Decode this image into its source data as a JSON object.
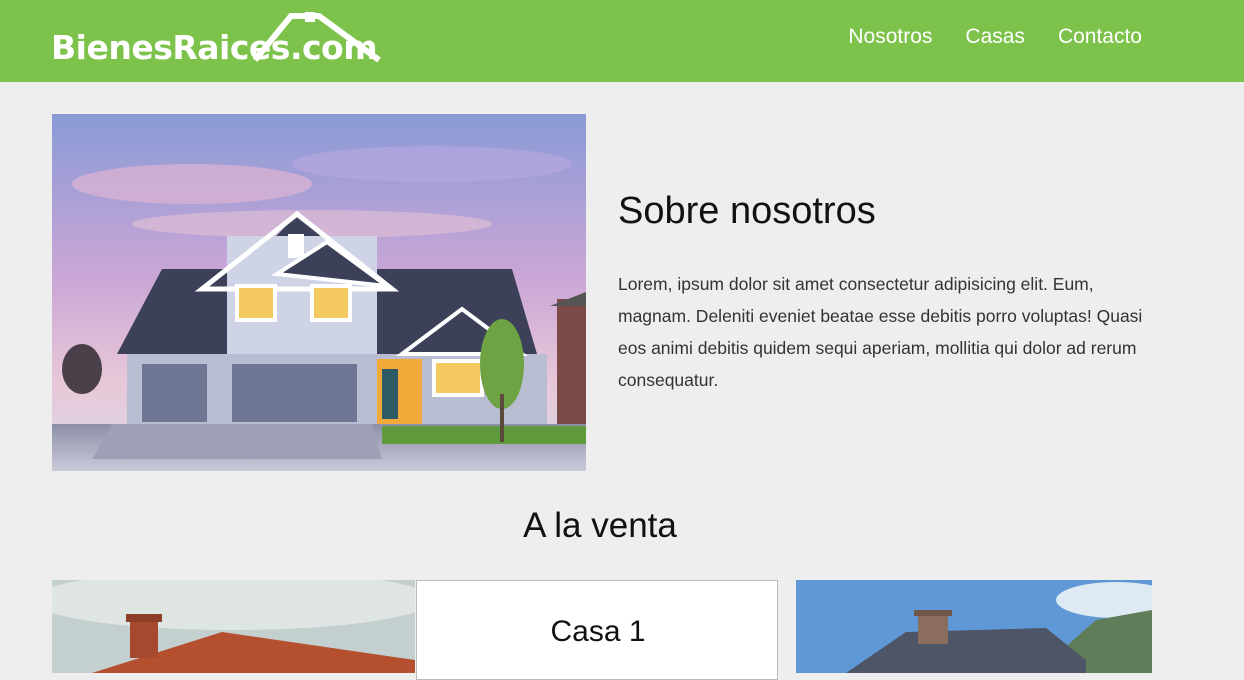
{
  "header": {
    "logo_text": "BienesRaices.com",
    "background_color": "#7dc24b",
    "nav": [
      {
        "label": "Nosotros"
      },
      {
        "label": "Casas"
      },
      {
        "label": "Contacto"
      }
    ]
  },
  "about": {
    "title": "Sobre nosotros",
    "text": "Lorem, ipsum dolor sit amet consectetur adipisicing elit. Eum, magnam. Deleniti eveniet beatae esse debitis porro voluptas! Quasi eos animi debitis quidem sequi aperiam, mollitia qui dolor ad rerum consequatur."
  },
  "sale": {
    "title": "A la venta",
    "cards": [
      {
        "image": "house-photo"
      },
      {
        "title": "Casa 1"
      },
      {
        "image": "house-photo"
      }
    ]
  }
}
